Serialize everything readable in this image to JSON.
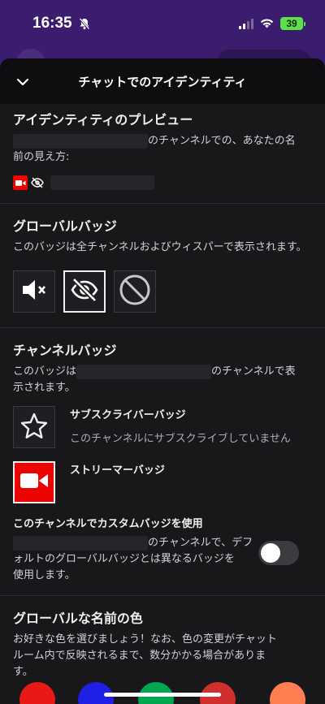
{
  "status_bar": {
    "time": "16:35",
    "battery": "39"
  },
  "header": {
    "title": "チャットでのアイデンティティ"
  },
  "preview": {
    "title": "アイデンティティのプレビュー",
    "desc_after_channel": "のチャンネルでの、あなたの名",
    "desc_line2": "前の見え方:"
  },
  "global_badge": {
    "title": "グローバルバッジ",
    "desc": "このバッジは全チャンネルおよびウィスパーで表示されます。",
    "options": [
      {
        "icon": "muted-speaker-icon"
      },
      {
        "icon": "eye-slash-icon",
        "selected": true
      },
      {
        "icon": "no-badge-icon"
      }
    ]
  },
  "channel_badge": {
    "title": "チャンネルバッジ",
    "desc_before": "このバッジは",
    "desc_after": "のチャンネルで表",
    "desc_line2": "示されます。",
    "items": [
      {
        "title": "サブスクライバーバッジ",
        "subtitle": "このチャンネルにサブスクライブしていません",
        "icon": "star-icon"
      },
      {
        "title": "ストリーマーバッジ",
        "subtitle": "",
        "icon": "camera-icon"
      }
    ]
  },
  "custom_badge": {
    "title": "このチャンネルでカスタムバッジを使用",
    "desc_line1_after": "のチャンネルで、デフ",
    "desc_line2": "ォルトのグローバルバッジとは異なるバッジを",
    "desc_line3": "使用します。",
    "enabled": false
  },
  "name_color": {
    "title": "グローバルな名前の色",
    "desc_line1": "お好きな色を選びましょう！なお、色の変更がチャット",
    "desc_line2": "ルーム内で反映されるまで、数分かかる場合がありま",
    "desc_line3": "す。",
    "swatches": [
      "#e91916",
      "#1f1fe6",
      "#00a651",
      "#d12e2e",
      "#ff7f50"
    ]
  },
  "colors": {
    "accent_red": "#eb0400",
    "bg": "#18181b",
    "header_bg": "#0e0e10"
  }
}
